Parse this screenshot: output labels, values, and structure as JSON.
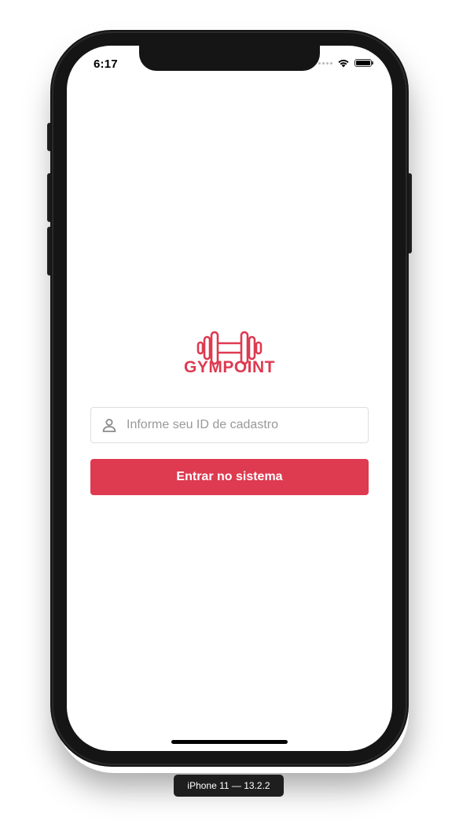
{
  "status_bar": {
    "time": "6:17",
    "icons": [
      "signal-dots-icon",
      "wifi-icon",
      "battery-icon"
    ],
    "battery_level": 1.0
  },
  "app": {
    "logo_icon": "dumbbell-icon",
    "name": "GYMPOINT",
    "accent_color": "#de3a50"
  },
  "login": {
    "id_field": {
      "icon": "user-icon",
      "placeholder": "Informe seu ID de cadastro",
      "value": ""
    },
    "submit_label": "Entrar no sistema"
  },
  "simulator": {
    "device_label": "iPhone 11 — 13.2.2"
  }
}
